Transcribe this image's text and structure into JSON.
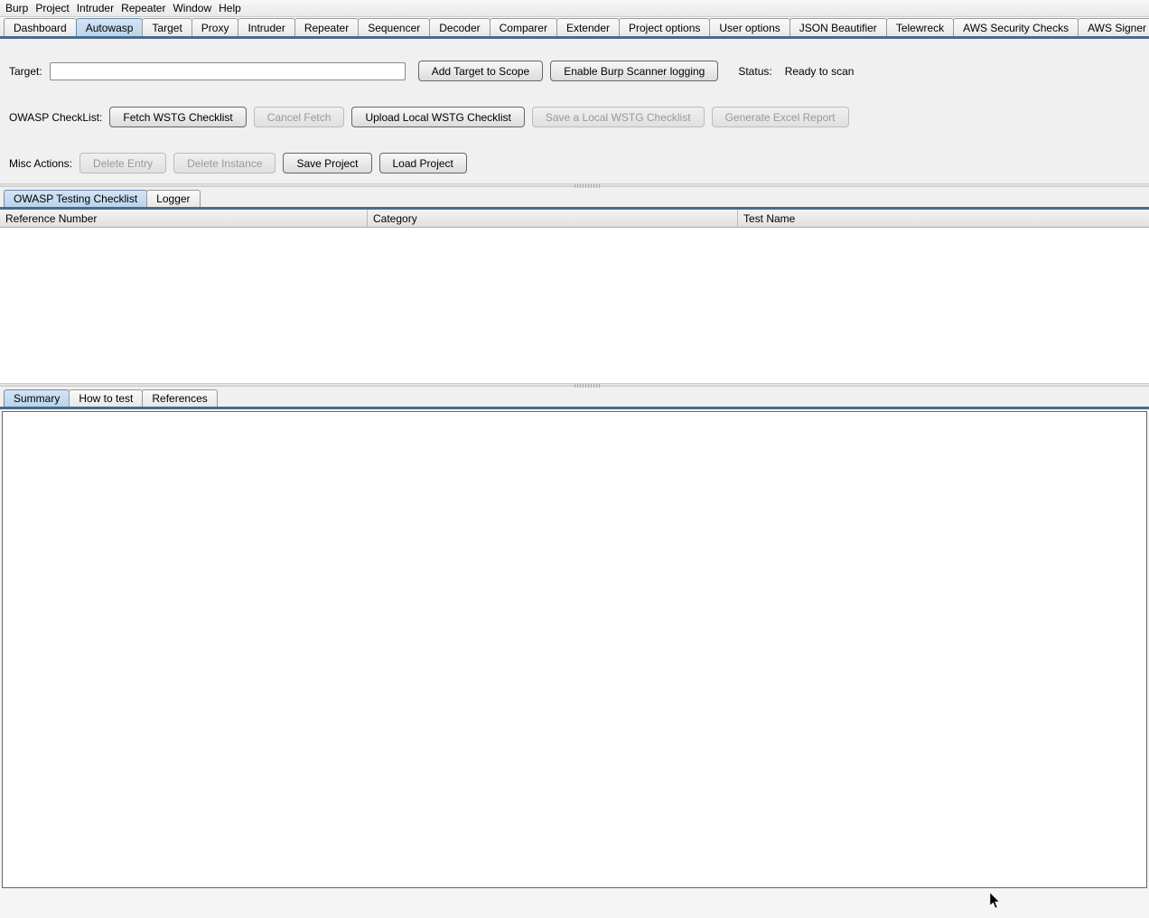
{
  "menubar": [
    "Burp",
    "Project",
    "Intruder",
    "Repeater",
    "Window",
    "Help"
  ],
  "app_tabs": [
    {
      "label": "Dashboard",
      "active": false
    },
    {
      "label": "Autowasp",
      "active": true
    },
    {
      "label": "Target",
      "active": false
    },
    {
      "label": "Proxy",
      "active": false
    },
    {
      "label": "Intruder",
      "active": false
    },
    {
      "label": "Repeater",
      "active": false
    },
    {
      "label": "Sequencer",
      "active": false
    },
    {
      "label": "Decoder",
      "active": false
    },
    {
      "label": "Comparer",
      "active": false
    },
    {
      "label": "Extender",
      "active": false
    },
    {
      "label": "Project options",
      "active": false
    },
    {
      "label": "User options",
      "active": false
    },
    {
      "label": "JSON Beautifier",
      "active": false
    },
    {
      "label": "Telewreck",
      "active": false
    },
    {
      "label": "AWS Security Checks",
      "active": false
    },
    {
      "label": "AWS Signer",
      "active": false
    }
  ],
  "target": {
    "label": "Target:",
    "value": "",
    "add_btn": "Add Target to Scope",
    "enable_logging_btn": "Enable Burp Scanner logging",
    "status_label": "Status:",
    "status_value": "Ready to scan"
  },
  "owasp_checklist": {
    "label": "OWASP CheckList:",
    "fetch_btn": "Fetch WSTG Checklist",
    "cancel_btn": "Cancel Fetch",
    "upload_btn": "Upload Local WSTG Checklist",
    "save_btn": "Save a Local WSTG Checklist",
    "excel_btn": "Generate Excel Report"
  },
  "misc_actions": {
    "label": "Misc Actions:",
    "delete_entry_btn": "Delete Entry",
    "delete_instance_btn": "Delete Instance",
    "save_project_btn": "Save Project",
    "load_project_btn": "Load Project"
  },
  "mid_tabs": [
    {
      "label": "OWASP Testing Checklist",
      "active": true
    },
    {
      "label": "Logger",
      "active": false
    }
  ],
  "table_headers": [
    "Reference Number",
    "Category",
    "Test Name"
  ],
  "detail_tabs": [
    {
      "label": "Summary",
      "active": true
    },
    {
      "label": "How to test",
      "active": false
    },
    {
      "label": "References",
      "active": false
    }
  ]
}
